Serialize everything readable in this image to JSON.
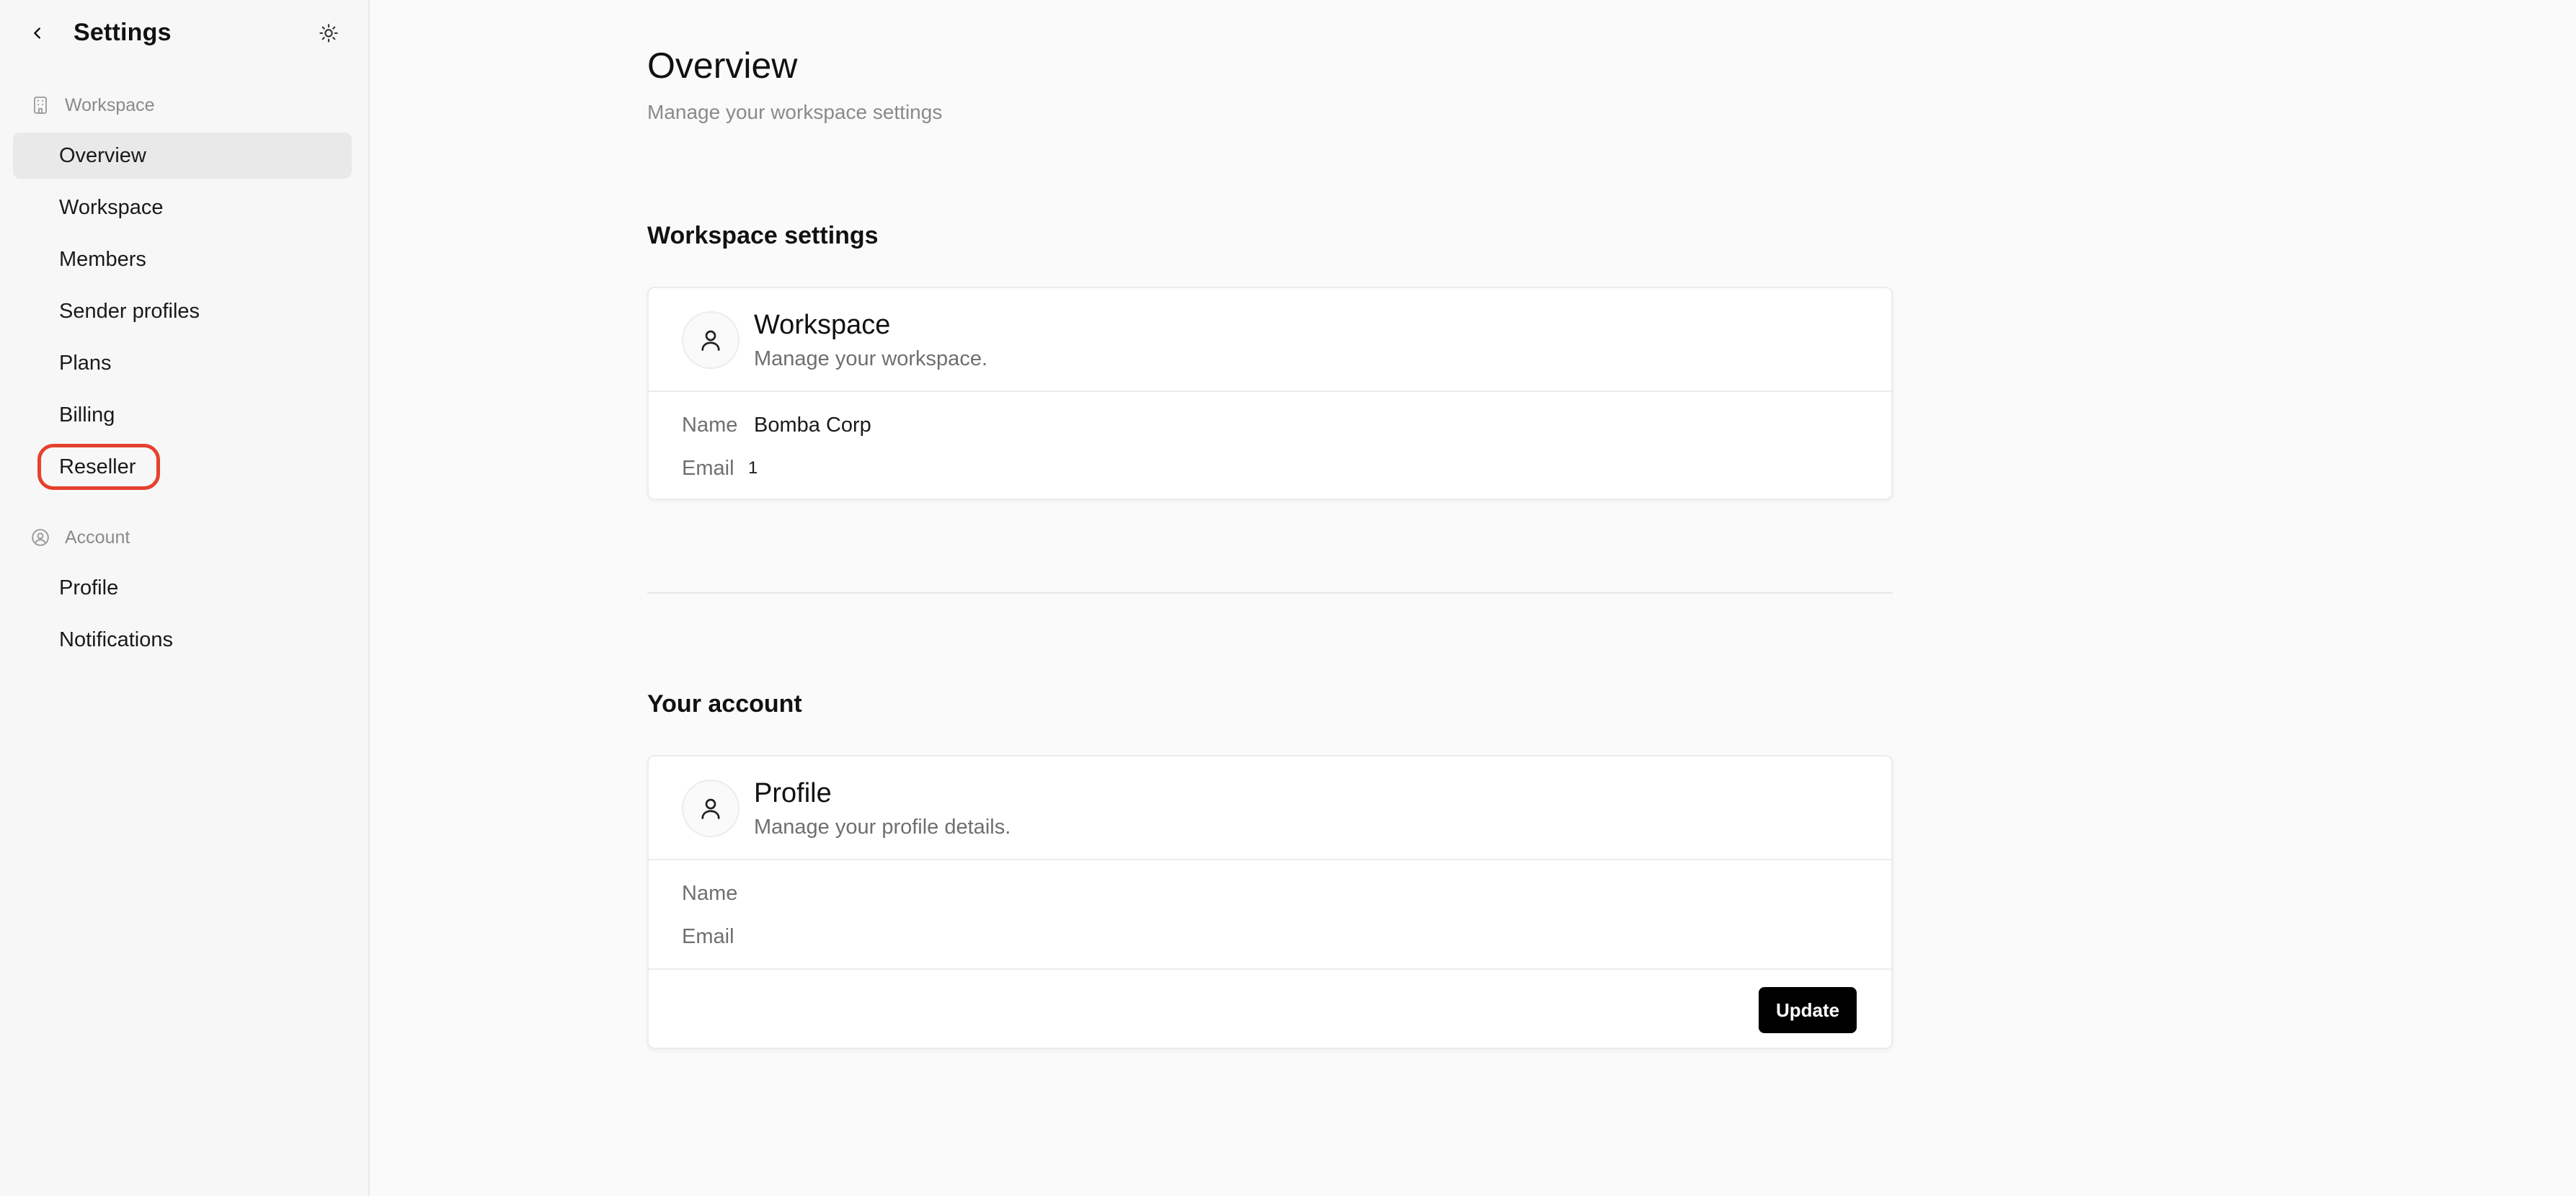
{
  "sidebar": {
    "title": "Settings",
    "groups": [
      {
        "label": "Workspace",
        "icon": "building-icon",
        "items": [
          {
            "label": "Overview",
            "active": true
          },
          {
            "label": "Workspace"
          },
          {
            "label": "Members"
          },
          {
            "label": "Sender profiles"
          },
          {
            "label": "Plans"
          },
          {
            "label": "Billing"
          },
          {
            "label": "Reseller",
            "highlighted": true
          }
        ]
      },
      {
        "label": "Account",
        "icon": "user-circle-icon",
        "items": [
          {
            "label": "Profile"
          },
          {
            "label": "Notifications"
          }
        ]
      }
    ]
  },
  "main": {
    "title": "Overview",
    "subtitle": "Manage your workspace settings",
    "workspace_section": {
      "heading": "Workspace settings",
      "card": {
        "title": "Workspace",
        "description": "Manage your workspace.",
        "name_label": "Name",
        "name_value": "Bomba Corp",
        "email_label": "Email",
        "email_value": "1"
      }
    },
    "account_section": {
      "heading": "Your account",
      "card": {
        "title": "Profile",
        "description": "Manage your profile details.",
        "name_label": "Name",
        "name_value": "",
        "email_label": "Email",
        "email_value": "",
        "update_label": "Update"
      }
    }
  },
  "colors": {
    "highlight_ring": "#e5412d",
    "active_item_bg": "#e9e9e9",
    "primary_button": "#000000"
  }
}
